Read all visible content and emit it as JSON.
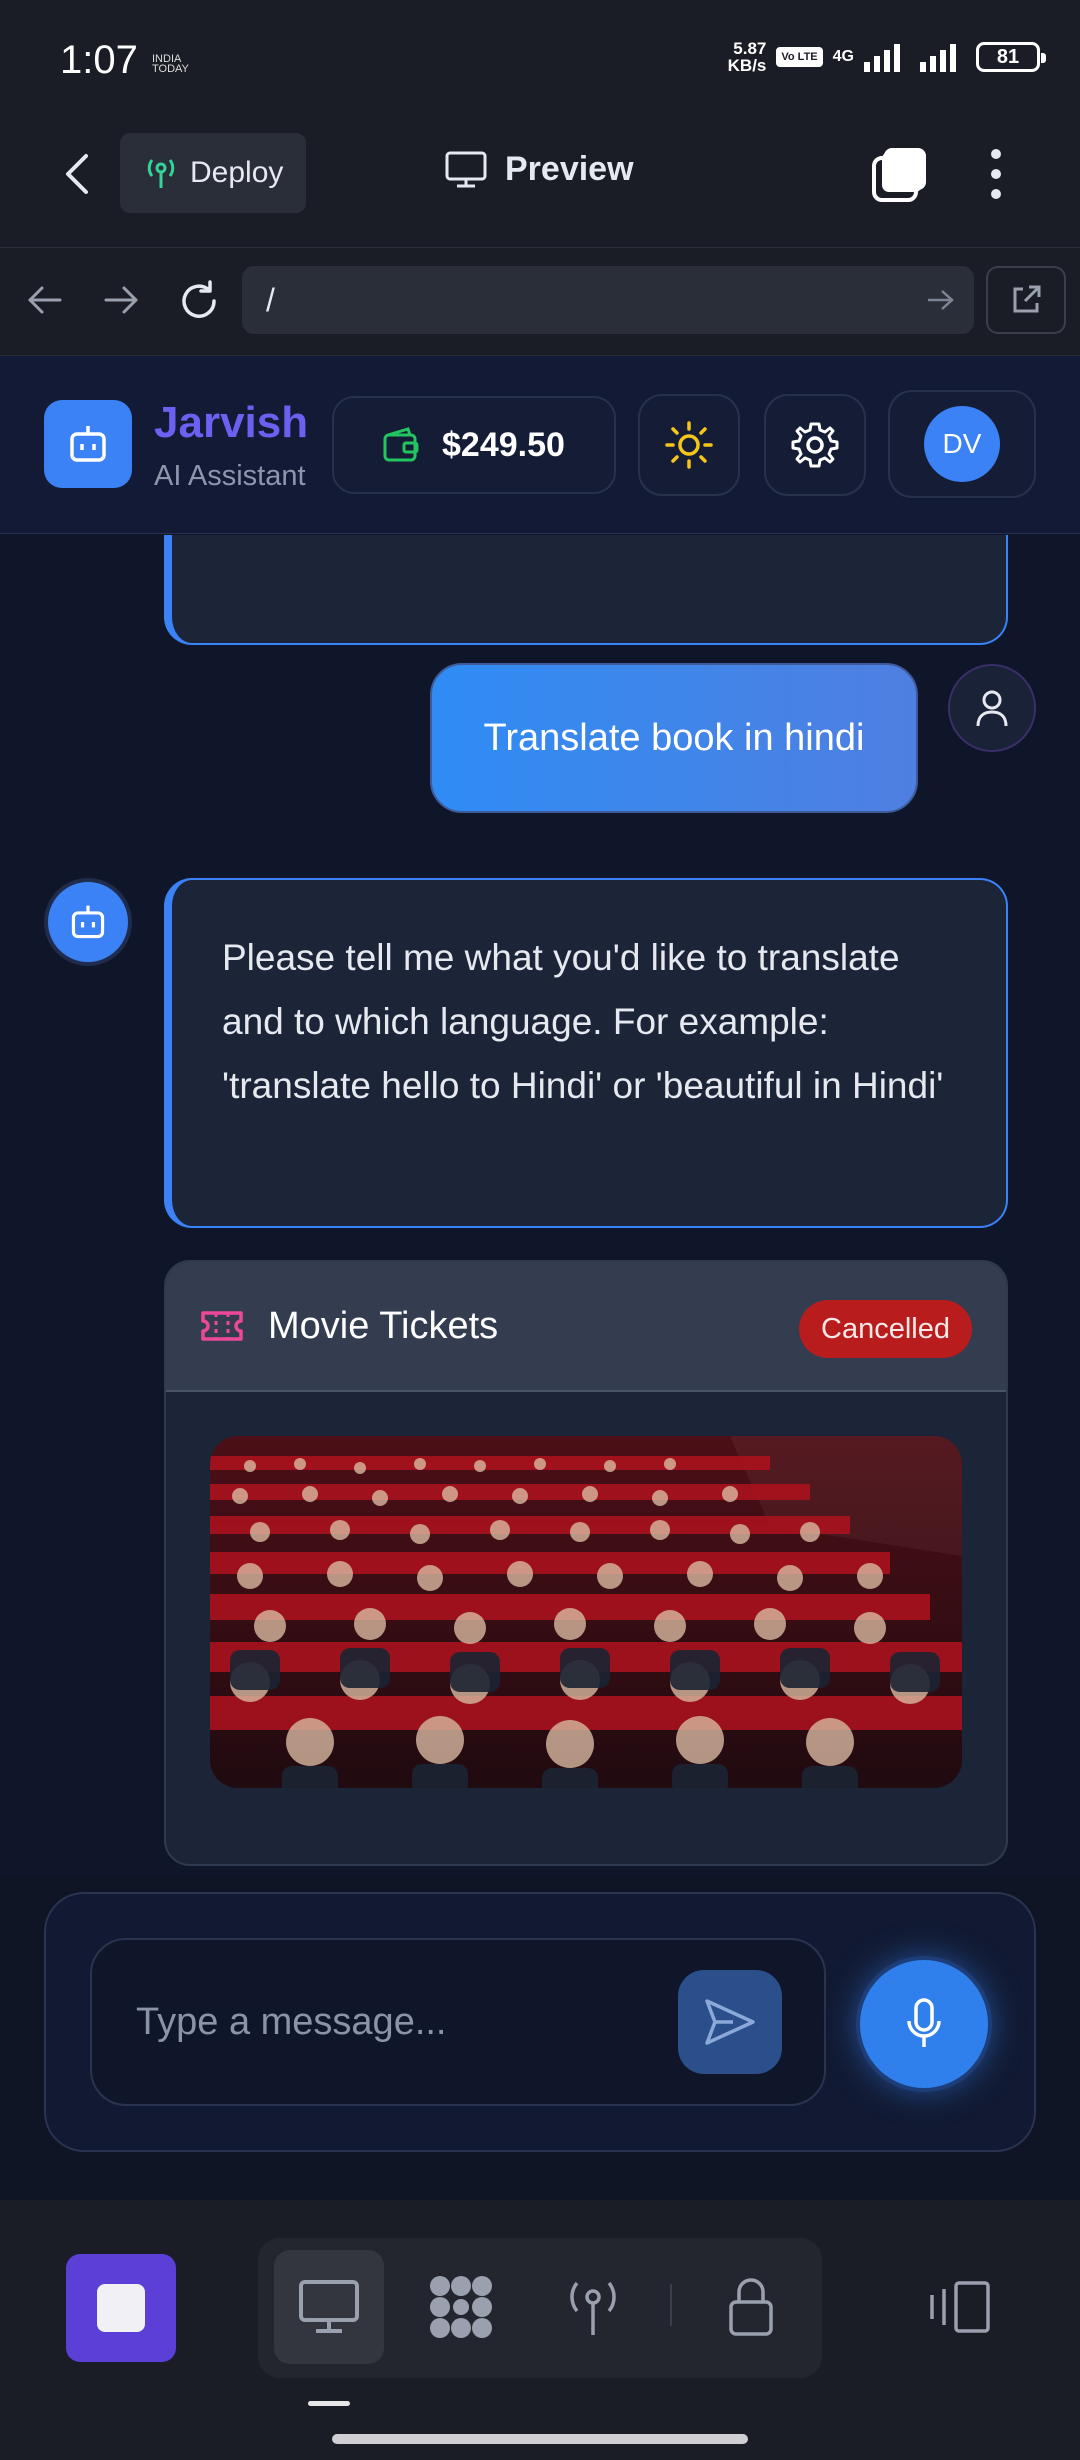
{
  "status_bar": {
    "time": "1:07",
    "brand": "INDIA TODAY",
    "net_speed_value": "5.87",
    "net_speed_unit": "KB/s",
    "volte": "Vo LTE",
    "network": "4G",
    "battery": "81"
  },
  "top_nav": {
    "deploy_label": "Deploy",
    "preview_label": "Preview"
  },
  "url_bar": {
    "value": "/"
  },
  "app_header": {
    "name": "Jarvish",
    "subtitle": "AI Assistant",
    "balance": "$249.50",
    "avatar_initials": "DV",
    "colors": {
      "brand": "#6d5ff0",
      "accent": "#3b82f6"
    }
  },
  "chat": {
    "user_message": "Translate book in hindi",
    "bot_message": "Please tell me what you'd like to translate and to which language. For example: 'translate hello to Hindi' or 'beautiful in Hindi'",
    "ticket_card": {
      "title": "Movie Tickets",
      "status": "Cancelled",
      "image_alt": "Movie theater audience"
    }
  },
  "composer": {
    "placeholder": "Type a message..."
  },
  "bottom_bar": {
    "tools": [
      "monitor-icon",
      "apps-grid-icon",
      "deploy-antenna-icon",
      "lock-icon",
      "split-view-icon"
    ]
  }
}
